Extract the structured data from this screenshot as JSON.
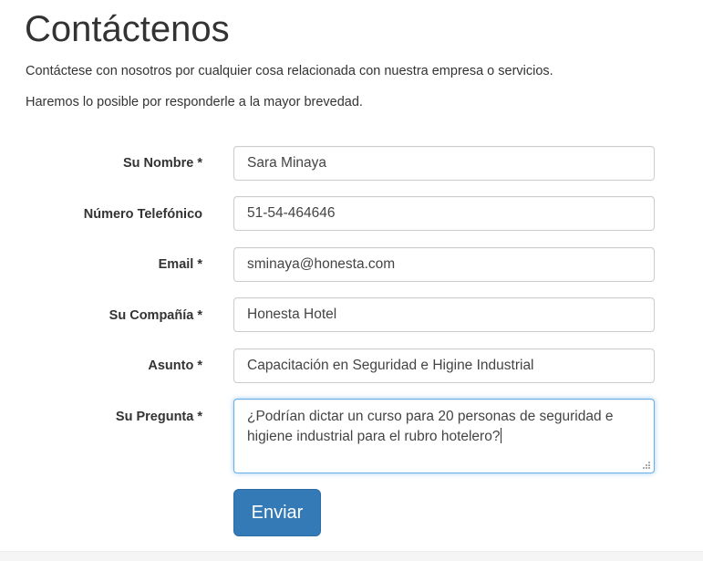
{
  "page": {
    "title": "Contáctenos",
    "intro_line_1": "Contáctese con nosotros por cualquier cosa relacionada con nuestra empresa o servicios.",
    "intro_line_2": "Haremos lo posible por responderle a la mayor brevedad."
  },
  "form": {
    "name": {
      "label": "Su Nombre *",
      "value": "Sara Minaya"
    },
    "phone": {
      "label": "Número Telefónico",
      "value": "51-54-464646"
    },
    "email": {
      "label": "Email *",
      "value": "sminaya@honesta.com"
    },
    "company": {
      "label": "Su Compañía *",
      "value": "Honesta Hotel"
    },
    "subject": {
      "label": "Asunto *",
      "value": "Capacitación en Seguridad e Higine Industrial"
    },
    "question": {
      "label": "Su Pregunta *",
      "value": "¿Podrían dictar un curso para 20 personas de seguridad e higiene industrial para el rubro hotelero?"
    },
    "submit_label": "Enviar"
  },
  "colors": {
    "primary_button": "#337ab7",
    "focus_border": "#66afe9",
    "text": "#333333"
  },
  "icons": {
    "textarea_resize": "resize-grip-icon"
  }
}
